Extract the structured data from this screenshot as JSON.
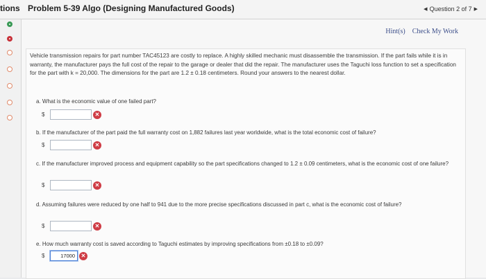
{
  "header": {
    "tab_label": "tions",
    "title": "Problem 5-39 Algo (Designing Manufactured Goods)",
    "question_nav": "Question 2 of 7"
  },
  "links": {
    "hint": "Hint(s)",
    "check": "Check My Work"
  },
  "question": {
    "intro": "Vehicle transmission repairs for part number TAC45123 are costly to replace. A highly skilled mechanic must disassemble the transmission. If the part fails while it is in warranty, the manufacturer pays the full cost of the repair to the garage or dealer that did the repair. The manufacturer uses the Taguchi loss function to set a specification for the part with k = 20,000. The dimensions for the part are 1.2 ± 0.18 centimeters. Round your answers to the nearest dollar.",
    "parts": [
      {
        "text": "a. What is the economic value of one failed part?",
        "currency": "$",
        "value": ""
      },
      {
        "text": "b. If the manufacturer of the part paid the full warranty cost on 1,882 failures last year worldwide, what is the total economic cost of failure?",
        "currency": "$",
        "value": ""
      },
      {
        "text": "c. If the manufacturer improved process and equipment capability so the part specifications changed to 1.2 ± 0.09 centimeters, what is the economic cost of one failure?",
        "currency": "$",
        "value": ""
      },
      {
        "text": "d. Assuming failures were reduced by one half to 941 due to the more precise specifications discussed in part c, what is the economic cost of failure?",
        "currency": "$",
        "value": ""
      },
      {
        "text": "e. How much warranty cost is saved according to Taguchi estimates by improving specifications from ±0.18 to ±0.09?",
        "currency": "$",
        "value": "17000"
      }
    ]
  },
  "status": {
    "incorrect_glyph": "✕"
  }
}
